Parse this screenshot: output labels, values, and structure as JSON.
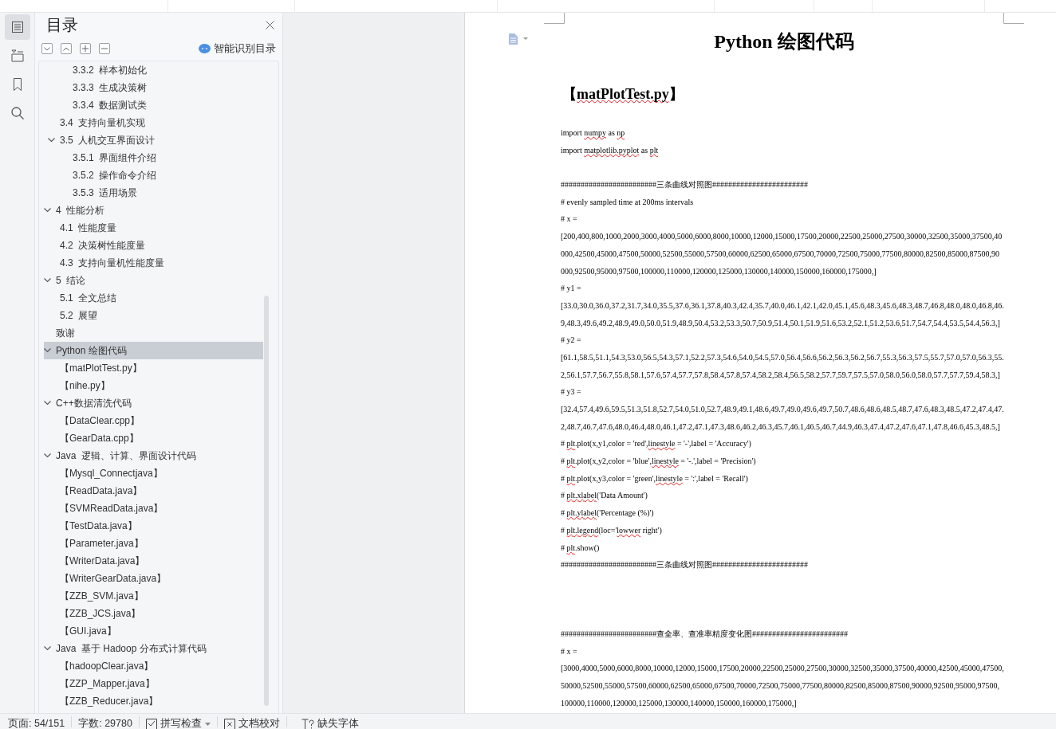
{
  "rail": [
    {
      "kind": "outline",
      "selected": true
    },
    {
      "kind": "structure",
      "selected": false
    },
    {
      "kind": "bookmark",
      "selected": false
    },
    {
      "kind": "search",
      "selected": false
    }
  ],
  "sidebar": {
    "title": "目录",
    "smart_button": "智能识别目录",
    "toc": [
      {
        "children": [
          {
            "children": [
              {
                "label": "3.3.2  样本初始化",
                "selected": false
              },
              {
                "label": "3.3.3  生成决策树",
                "selected": false
              },
              {
                "label": "3.3.4  数据测试类",
                "selected": false
              }
            ]
          },
          {
            "label": "3.4  支持向量机实现",
            "selected": false
          },
          {
            "label": "3.5  人机交互界面设计",
            "selected": false,
            "expanded": true,
            "children": [
              {
                "label": "3.5.1  界面组件介绍",
                "selected": false
              },
              {
                "label": "3.5.2  操作命令介绍",
                "selected": false
              },
              {
                "label": "3.5.3  适用场景",
                "selected": false
              }
            ]
          }
        ]
      },
      {
        "label": "4  性能分析",
        "selected": false,
        "expanded": true,
        "children": [
          {
            "label": "4.1  性能度量",
            "selected": false
          },
          {
            "label": "4.2  决策树性能度量",
            "selected": false
          },
          {
            "label": "4.3  支持向量机性能度量",
            "selected": false
          }
        ]
      },
      {
        "label": "5  结论",
        "selected": false,
        "expanded": true,
        "children": [
          {
            "label": "5.1  全文总结",
            "selected": false
          },
          {
            "label": "5.2  展望",
            "selected": false
          }
        ]
      },
      {
        "label": "致谢",
        "selected": false
      },
      {
        "label": "Python 绘图代码",
        "selected": true,
        "expanded": true,
        "children": [
          {
            "label": "【matPlotTest.py】",
            "selected": false
          },
          {
            "label": "【nihe.py】",
            "selected": false
          }
        ]
      },
      {
        "label": "C++数据清洗代码",
        "selected": false,
        "expanded": true,
        "children": [
          {
            "label": "【DataClear.cpp】",
            "selected": false
          },
          {
            "label": "【GearData.cpp】",
            "selected": false
          }
        ]
      },
      {
        "label": "Java  逻辑、计算、界面设计代码",
        "selected": false,
        "expanded": true,
        "children": [
          {
            "label": "【Mysql_Connectjava】",
            "selected": false
          },
          {
            "label": "【ReadData.java】",
            "selected": false
          },
          {
            "label": "【SVMReadData.java】",
            "selected": false
          },
          {
            "label": "【TestData.java】",
            "selected": false
          },
          {
            "label": "【Parameter.java】",
            "selected": false
          },
          {
            "label": "【WriterData.java】",
            "selected": false
          },
          {
            "label": "【WriterGearData.java】",
            "selected": false
          },
          {
            "label": "【ZZB_SVM.java】",
            "selected": false
          },
          {
            "label": "【ZZB_JCS.java】",
            "selected": false
          },
          {
            "label": "【GUI.java】",
            "selected": false
          }
        ]
      },
      {
        "label": "Java  基于 Hadoop 分布式计算代码",
        "selected": false,
        "expanded": true,
        "children": [
          {
            "label": "【hadoopClear.java】",
            "selected": false
          },
          {
            "label": "【ZZP_Mapper.java】",
            "selected": false
          },
          {
            "label": "【ZZB_Reducer.java】",
            "selected": false
          }
        ]
      }
    ]
  },
  "document": {
    "title": "Python 绘图代码",
    "heading": [
      {
        "text": "【",
        "misspelled": false
      },
      {
        "text": "matPlotTest.py",
        "misspelled": true
      },
      {
        "text": "】",
        "misspelled": false
      }
    ],
    "lines": [
      {
        "kind": "text",
        "parts": [
          {
            "text": "import ",
            "misspelled": false
          },
          {
            "text": "numpy",
            "misspelled": true
          },
          {
            "text": " as ",
            "misspelled": false
          },
          {
            "text": "np",
            "misspelled": true
          }
        ]
      },
      {
        "kind": "text",
        "parts": [
          {
            "text": "import ",
            "misspelled": false
          },
          {
            "text": "matplotlib.pyplot",
            "misspelled": true
          },
          {
            "text": " as ",
            "misspelled": false
          },
          {
            "text": "plt",
            "misspelled": true
          }
        ]
      },
      {
        "kind": "blank"
      },
      {
        "kind": "text",
        "parts": [
          {
            "text": "########################三条曲线对照图########################",
            "misspelled": false
          }
        ]
      },
      {
        "kind": "text",
        "parts": [
          {
            "text": "# evenly sampled time at 200ms intervals",
            "misspelled": false
          }
        ]
      },
      {
        "kind": "text",
        "parts": [
          {
            "text": "# x =",
            "misspelled": false
          }
        ]
      },
      {
        "kind": "text",
        "parts": [
          {
            "text": "[200,400,800,1000,2000,3000,4000,5000,6000,8000,10000,12000,15000,17500,20000,22500,25000,27500,30000,32500,35000,37500,40",
            "misspelled": false
          }
        ]
      },
      {
        "kind": "text",
        "parts": [
          {
            "text": "000,42500,45000,47500,50000,52500,55000,57500,60000,62500,65000,67500,70000,72500,75000,77500,80000,82500,85000,87500,90",
            "misspelled": false
          }
        ]
      },
      {
        "kind": "text",
        "parts": [
          {
            "text": "000,92500,95000,97500,100000,110000,120000,125000,130000,140000,150000,160000,175000,]",
            "misspelled": false
          }
        ]
      },
      {
        "kind": "text",
        "parts": [
          {
            "text": "# y1 =",
            "misspelled": false
          }
        ]
      },
      {
        "kind": "text",
        "parts": [
          {
            "text": "[33.0,30.0,36.0,37.2,31.7,34.0,35.5,37.6,36.1,37.8,40.3,42.4,35.7,40.0,46.1,42.1,42.0,45.1,45.6,48.3,45.6,48.3,48.7,46.8,48.0,48.0,46.8,46.",
            "misspelled": false
          }
        ]
      },
      {
        "kind": "text",
        "parts": [
          {
            "text": "9,48.3,49.6,49.2,48.9,49.0,50.0,51.9,48.9,50.4,53.2,53.3,50.7,50.9,51.4,50.1,51.9,51.6,53.2,52.1,51.2,53.6,51.7,54.7,54.4,53.5,54.4,56.3,]",
            "misspelled": false
          }
        ]
      },
      {
        "kind": "text",
        "parts": [
          {
            "text": "# y2 =",
            "misspelled": false
          }
        ]
      },
      {
        "kind": "text",
        "parts": [
          {
            "text": "[61.1,58.5,51.1,54.3,53.0,56.5,54.3,57.1,52.2,57.3,54.6,54.0,54.5,57.0,56.4,56.6,56.2,56.3,56.2,56.7,55.3,56.3,57.5,55.7,57.0,57.0,56.3,55.",
            "misspelled": false
          }
        ]
      },
      {
        "kind": "text",
        "parts": [
          {
            "text": "2,56.1,57.7,56.7,55.8,58.1,57.6,57.4,57.7,57.8,58.4,57.8,57.4,58.2,58.4,56.5,58.2,57.7,59.7,57.5,57.0,58.0,56.0,58.0,57.7,57.7,59.4,58.3,]",
            "misspelled": false
          }
        ]
      },
      {
        "kind": "text",
        "parts": [
          {
            "text": "# y3 =",
            "misspelled": false
          }
        ]
      },
      {
        "kind": "text",
        "parts": [
          {
            "text": "[32.4,57.4,49.6,59.5,51.3,51.8,52.7,54.0,51.0,52.7,48.9,49.1,48.6,49.7,49.0,49.6,49.7,50.7,48.6,48.6,48.5,48.7,47.6,48.3,48.5,47.2,47.4,47.",
            "misspelled": false
          }
        ]
      },
      {
        "kind": "text",
        "parts": [
          {
            "text": "2,48.7,46.7,47.6,48.0,46.4,48.0,46.1,47.2,47.1,47.3,48.6,46.2,46.3,45.7,46.1,46.5,46.7,44.9,46.3,47.4,47.2,47.6,47.1,47.8,46.6,45.3,48.5,]",
            "misspelled": false
          }
        ]
      },
      {
        "kind": "text",
        "parts": [
          {
            "text": "# ",
            "misspelled": false
          },
          {
            "text": "plt",
            "misspelled": true
          },
          {
            "text": ".plot(x,y1,color = 'red',",
            "misspelled": false
          },
          {
            "text": "linestyle",
            "misspelled": true
          },
          {
            "text": " = '-',label = 'Accuracy')",
            "misspelled": false
          }
        ]
      },
      {
        "kind": "text",
        "parts": [
          {
            "text": "# ",
            "misspelled": false
          },
          {
            "text": "plt",
            "misspelled": true
          },
          {
            "text": ".plot(x,y2,color = 'blue',",
            "misspelled": false
          },
          {
            "text": "linestyle",
            "misspelled": true
          },
          {
            "text": " = '-.',label = 'Precision')",
            "misspelled": false
          }
        ]
      },
      {
        "kind": "text",
        "parts": [
          {
            "text": "# ",
            "misspelled": false
          },
          {
            "text": "plt",
            "misspelled": true
          },
          {
            "text": ".plot(x,y3,color = 'green',",
            "misspelled": false
          },
          {
            "text": "linestyle",
            "misspelled": true
          },
          {
            "text": " = ':',label = 'Recall')",
            "misspelled": false
          }
        ]
      },
      {
        "kind": "text",
        "parts": [
          {
            "text": "# ",
            "misspelled": false
          },
          {
            "text": "plt.xlabel",
            "misspelled": true
          },
          {
            "text": "('Data Amount')",
            "misspelled": false
          }
        ]
      },
      {
        "kind": "text",
        "parts": [
          {
            "text": "# ",
            "misspelled": false
          },
          {
            "text": "plt.ylabel",
            "misspelled": true
          },
          {
            "text": "('Percentage (%)')",
            "misspelled": false
          }
        ]
      },
      {
        "kind": "text",
        "parts": [
          {
            "text": "# ",
            "misspelled": false
          },
          {
            "text": "plt.legend",
            "misspelled": true
          },
          {
            "text": "(loc='",
            "misspelled": false
          },
          {
            "text": "lowwer",
            "misspelled": true
          },
          {
            "text": " right')",
            "misspelled": false
          }
        ]
      },
      {
        "kind": "text",
        "parts": [
          {
            "text": "# ",
            "misspelled": false
          },
          {
            "text": "plt",
            "misspelled": true
          },
          {
            "text": ".show()",
            "misspelled": false
          }
        ]
      },
      {
        "kind": "text",
        "parts": [
          {
            "text": "########################三条曲线对照图########################",
            "misspelled": false
          }
        ]
      },
      {
        "kind": "blank"
      },
      {
        "kind": "blank"
      },
      {
        "kind": "blank"
      },
      {
        "kind": "text",
        "parts": [
          {
            "text": "########################查全率、查准率精度变化图########################",
            "misspelled": false
          }
        ]
      },
      {
        "kind": "text",
        "parts": [
          {
            "text": "# x =",
            "misspelled": false
          }
        ]
      },
      {
        "kind": "text",
        "parts": [
          {
            "text": "[3000,4000,5000,6000,8000,10000,12000,15000,17500,20000,22500,25000,27500,30000,32500,35000,37500,40000,42500,45000,47500,",
            "misspelled": false
          }
        ]
      },
      {
        "kind": "text",
        "parts": [
          {
            "text": "50000,52500,55000,57500,60000,62500,65000,67500,70000,72500,75000,77500,80000,82500,85000,87500,90000,92500,95000,97500,",
            "misspelled": false
          }
        ]
      },
      {
        "kind": "text",
        "parts": [
          {
            "text": "100000,110000,120000,125000,130000,140000,150000,160000,175000,]",
            "misspelled": false
          }
        ]
      }
    ]
  },
  "status_bar": {
    "page": "页面: 54/151",
    "words": "字数: 29780",
    "spell_check": "拼写检查",
    "proofread": "文档校对",
    "missing_fonts": "缺失字体"
  }
}
